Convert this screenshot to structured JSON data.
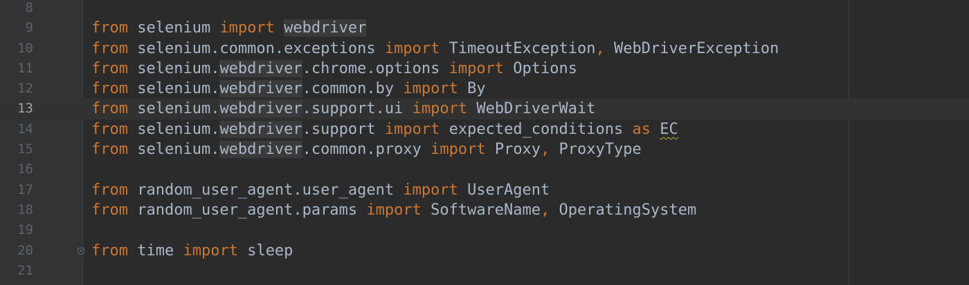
{
  "editor": {
    "colors": {
      "background": "#2b2b2b",
      "gutter": "#313335",
      "keyword": "#cc7832",
      "identifier": "#a9b7c6",
      "line_number": "#606366",
      "current_line": "#323232"
    },
    "current_line_number": "13",
    "lines": [
      {
        "num": "8",
        "tokens": []
      },
      {
        "num": "9",
        "tokens": [
          {
            "t": "from",
            "k": "kw"
          },
          {
            "t": " selenium ",
            "k": "id"
          },
          {
            "t": "import",
            "k": "kw"
          },
          {
            "t": " ",
            "k": "id"
          },
          {
            "t": "webdriver",
            "k": "id",
            "hl": true
          }
        ]
      },
      {
        "num": "10",
        "tokens": [
          {
            "t": "from",
            "k": "kw"
          },
          {
            "t": " selenium.common.exceptions ",
            "k": "id"
          },
          {
            "t": "import",
            "k": "kw"
          },
          {
            "t": " TimeoutException",
            "k": "id"
          },
          {
            "t": ",",
            "k": "kw"
          },
          {
            "t": " WebDriverException",
            "k": "id"
          }
        ]
      },
      {
        "num": "11",
        "tokens": [
          {
            "t": "from",
            "k": "kw"
          },
          {
            "t": " selenium.",
            "k": "id"
          },
          {
            "t": "webdriver",
            "k": "id",
            "hl": true
          },
          {
            "t": ".chrome.options ",
            "k": "id"
          },
          {
            "t": "import",
            "k": "kw"
          },
          {
            "t": " Options",
            "k": "id"
          }
        ]
      },
      {
        "num": "12",
        "tokens": [
          {
            "t": "from",
            "k": "kw"
          },
          {
            "t": " selenium.",
            "k": "id"
          },
          {
            "t": "webdriver",
            "k": "id",
            "hl": true
          },
          {
            "t": ".common.by ",
            "k": "id"
          },
          {
            "t": "import",
            "k": "kw"
          },
          {
            "t": " By",
            "k": "id"
          }
        ]
      },
      {
        "num": "13",
        "current": true,
        "tokens": [
          {
            "t": "from",
            "k": "kw"
          },
          {
            "t": " selenium.",
            "k": "id"
          },
          {
            "t": "webdriver",
            "k": "id",
            "hl": true
          },
          {
            "t": ".support.ui ",
            "k": "id"
          },
          {
            "t": "import",
            "k": "kw"
          },
          {
            "t": " WebDriverWait",
            "k": "id"
          }
        ]
      },
      {
        "num": "14",
        "tokens": [
          {
            "t": "from",
            "k": "kw"
          },
          {
            "t": " selenium.",
            "k": "id"
          },
          {
            "t": "webdriver",
            "k": "id",
            "hl": true
          },
          {
            "t": ".support ",
            "k": "id"
          },
          {
            "t": "import",
            "k": "kw"
          },
          {
            "t": " expected_conditions ",
            "k": "id"
          },
          {
            "t": "as",
            "k": "kw"
          },
          {
            "t": " ",
            "k": "id"
          },
          {
            "t": "EC",
            "k": "id",
            "warn": true
          }
        ]
      },
      {
        "num": "15",
        "tokens": [
          {
            "t": "from",
            "k": "kw"
          },
          {
            "t": " selenium.",
            "k": "id"
          },
          {
            "t": "webdriver",
            "k": "id",
            "hl": true
          },
          {
            "t": ".common.proxy ",
            "k": "id"
          },
          {
            "t": "import",
            "k": "kw"
          },
          {
            "t": " Proxy",
            "k": "id"
          },
          {
            "t": ",",
            "k": "kw"
          },
          {
            "t": " ProxyType",
            "k": "id"
          }
        ]
      },
      {
        "num": "16",
        "tokens": []
      },
      {
        "num": "17",
        "tokens": [
          {
            "t": "from",
            "k": "kw"
          },
          {
            "t": " random_user_agent.user_agent ",
            "k": "id"
          },
          {
            "t": "import",
            "k": "kw"
          },
          {
            "t": " UserAgent",
            "k": "id"
          }
        ]
      },
      {
        "num": "18",
        "tokens": [
          {
            "t": "from",
            "k": "kw"
          },
          {
            "t": " random_user_agent.params ",
            "k": "id"
          },
          {
            "t": "import",
            "k": "kw"
          },
          {
            "t": " SoftwareName",
            "k": "id"
          },
          {
            "t": ",",
            "k": "kw"
          },
          {
            "t": " OperatingSystem",
            "k": "id"
          }
        ]
      },
      {
        "num": "19",
        "tokens": []
      },
      {
        "num": "20",
        "fold": true,
        "tokens": [
          {
            "t": "from",
            "k": "kw"
          },
          {
            "t": " time ",
            "k": "id"
          },
          {
            "t": "import",
            "k": "kw"
          },
          {
            "t": " sleep",
            "k": "id"
          }
        ]
      },
      {
        "num": "21",
        "tokens": []
      }
    ]
  }
}
